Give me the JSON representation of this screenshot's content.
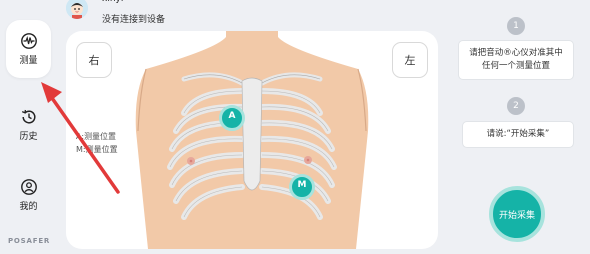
{
  "sidebar": {
    "items": [
      {
        "label": "测量",
        "icon": "heartbeat-icon",
        "active": true
      },
      {
        "label": "历史",
        "icon": "history-icon",
        "active": false
      },
      {
        "label": "我的",
        "icon": "user-icon",
        "active": false
      }
    ],
    "brand": "POSAFER"
  },
  "header": {
    "username": "xinyi",
    "status": "没有连接到设备"
  },
  "panel": {
    "right_label": "右",
    "left_label": "左",
    "legend_a": "A:测量位置",
    "legend_m": "M:测量位置",
    "marker_a": "A",
    "marker_m": "M"
  },
  "steps": [
    {
      "number": "1",
      "text_line1": "请把音动®心仪对准其中",
      "text_line2": "任何一个测量位置"
    },
    {
      "number": "2",
      "text": "请说:“开始采集”"
    }
  ],
  "start_button": "开始采集",
  "colors": {
    "accent": "#15b3a7",
    "background": "#eef0f4",
    "skin": "#f2c9a8"
  }
}
